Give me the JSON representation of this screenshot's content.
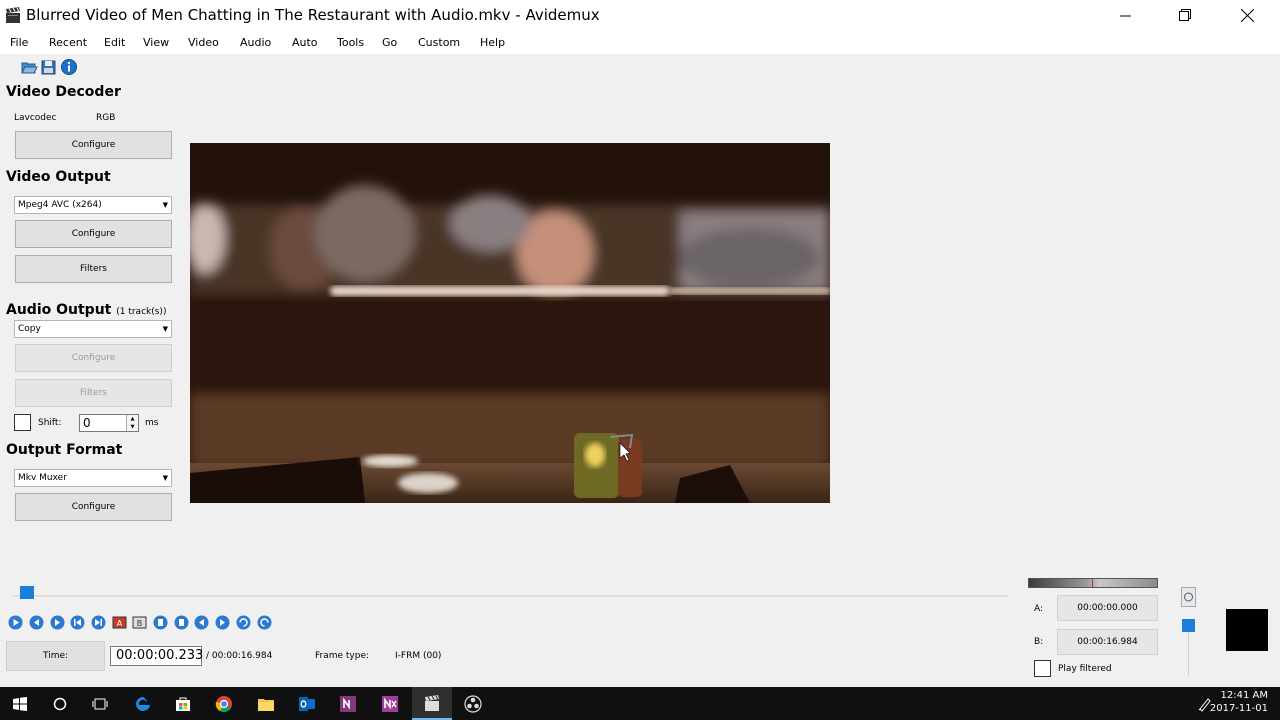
{
  "window": {
    "title": "Blurred Video of Men Chatting in The Restaurant with Audio.mkv - Avidemux"
  },
  "menu": [
    "File",
    "Recent",
    "Edit",
    "View",
    "Video",
    "Audio",
    "Auto",
    "Tools",
    "Go",
    "Custom",
    "Help"
  ],
  "toolbar": {
    "icons": [
      "open-file-icon",
      "save-file-icon",
      "info-icon"
    ]
  },
  "video_decoder": {
    "title": "Video Decoder",
    "decoder": "Lavcodec",
    "format": "RGB",
    "configure_label": "Configure"
  },
  "video_output": {
    "title": "Video Output",
    "codec": "Mpeg4 AVC (x264)",
    "configure_label": "Configure",
    "filters_label": "Filters"
  },
  "audio_output": {
    "title": "Audio Output",
    "tracks": "(1 track(s))",
    "codec": "Copy",
    "configure_label": "Configure",
    "filters_label": "Filters",
    "shift_label": "Shift:",
    "shift_value": "0",
    "shift_unit": "ms"
  },
  "output_format": {
    "title": "Output Format",
    "muxer": "Mkv Muxer",
    "configure_label": "Configure"
  },
  "playback": {
    "time_label": "Time:",
    "current_time": "00:00:00.233",
    "total_time": "/ 00:00:16.984",
    "frame_type_label": "Frame type:",
    "frame_type_value": "I-FRM (00)",
    "position_fraction": 0.014
  },
  "selection": {
    "a_label": "A:",
    "a_value": "00:00:00.000",
    "b_label": "B:",
    "b_value": "00:00:16.984",
    "play_filtered_label": "Play filtered"
  },
  "taskbar": {
    "icons": [
      "windows-start-icon",
      "cortana-icon",
      "task-view-icon",
      "edge-icon",
      "store-icon",
      "chrome-icon",
      "file-explorer-icon",
      "outlook-icon",
      "onenote-icon",
      "onenote-2016-icon",
      "avidemux-icon",
      "obs-icon"
    ],
    "time": "12:41 AM",
    "date": "2017-11-01"
  },
  "colors": {
    "accent": "#1a7fd8",
    "taskbar": "#101010"
  }
}
